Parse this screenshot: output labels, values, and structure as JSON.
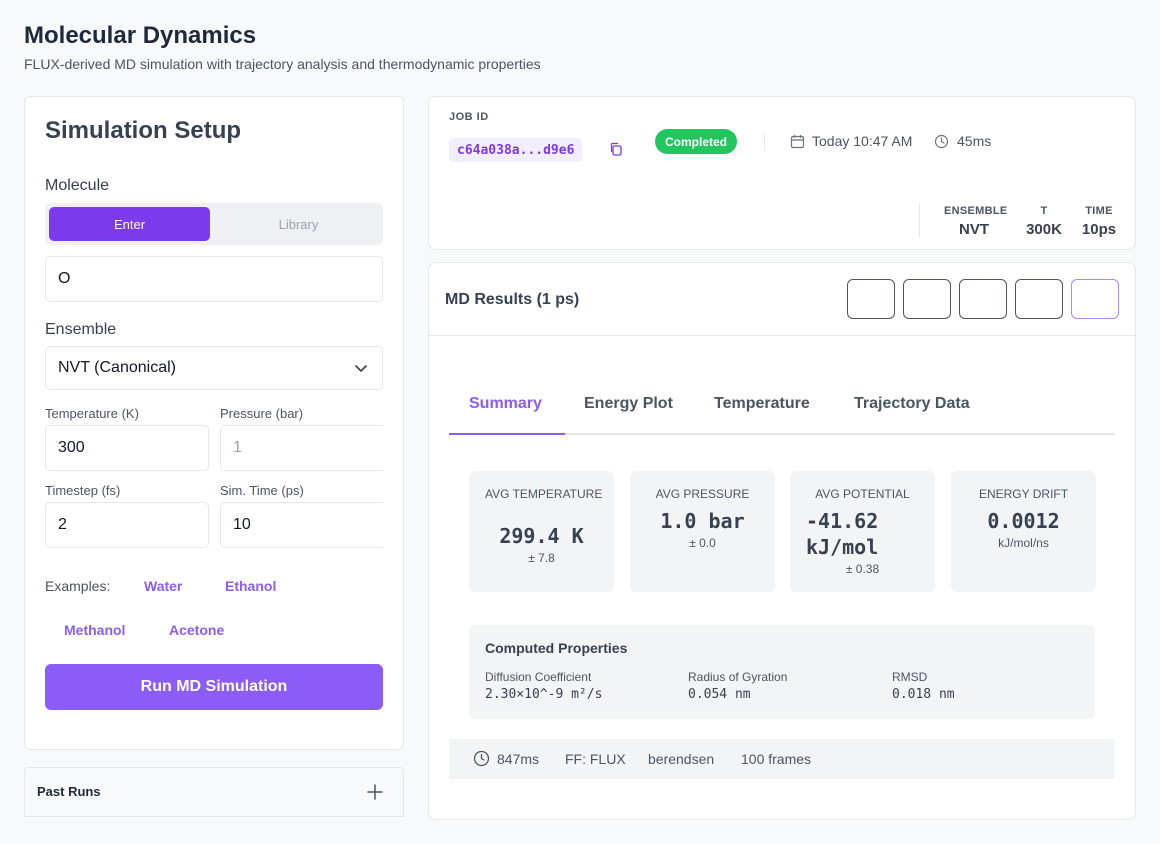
{
  "page": {
    "title": "Molecular Dynamics",
    "subtitle": "FLUX-derived MD simulation with trajectory analysis and thermodynamic properties"
  },
  "setup": {
    "title": "Simulation Setup",
    "molecule_label": "Molecule",
    "mode_enter": "Enter",
    "mode_library": "Library",
    "molecule_value": "O",
    "ensemble_label": "Ensemble",
    "ensemble_value": "NVT (Canonical)",
    "temperature_label": "Temperature (K)",
    "temperature_value": "300",
    "pressure_label": "Pressure (bar)",
    "pressure_placeholder": "1",
    "timestep_label": "Timestep (fs)",
    "timestep_value": "2",
    "simtime_label": "Sim. Time (ps)",
    "simtime_value": "10",
    "examples_label": "Examples:",
    "examples": [
      "Water",
      "Ethanol",
      "Methanol",
      "Acetone"
    ],
    "run_button": "Run MD Simulation"
  },
  "past_runs": {
    "label": "Past Runs"
  },
  "job": {
    "id_label": "JOB ID",
    "id_value": "c64a038a...d9e6",
    "status": "Completed",
    "date": "Today 10:47 AM",
    "duration": "45ms",
    "stats": [
      {
        "label": "ENSEMBLE",
        "value": "NVT"
      },
      {
        "label": "T",
        "value": "300K"
      },
      {
        "label": "TIME",
        "value": "10ps"
      }
    ]
  },
  "results": {
    "title": "MD Results (1 ps)",
    "tabs": [
      "Summary",
      "Energy Plot",
      "Temperature",
      "Trajectory Data"
    ],
    "active_tab": "Summary",
    "metrics": [
      {
        "label": "AVG TEMPERATURE",
        "value": "299.4 K",
        "sub": "± 7.8"
      },
      {
        "label": "AVG PRESSURE",
        "value": "1.0 bar",
        "sub": "± 0.0"
      },
      {
        "label": "AVG POTENTIAL",
        "value_line1": "-41.62",
        "value_line2": "kJ/mol",
        "sub": "± 0.38"
      },
      {
        "label": "ENERGY DRIFT",
        "value": "0.0012",
        "sub": "kJ/mol/ns"
      }
    ],
    "computed_title": "Computed Properties",
    "properties": [
      {
        "name": "Diffusion Coefficient",
        "value": "2.30×10^-9 m²/s"
      },
      {
        "name": "Radius of Gyration",
        "value": "0.054 nm"
      },
      {
        "name": "RMSD",
        "value": "0.018 nm"
      }
    ],
    "footer": {
      "time": "847ms",
      "forcefield": "FF: FLUX",
      "thermostat": "berendsen",
      "frames": "100 frames"
    }
  },
  "colors": {
    "accent": "#8b5cf6",
    "accent_dark": "#7c3aed",
    "success": "#22c55e"
  }
}
